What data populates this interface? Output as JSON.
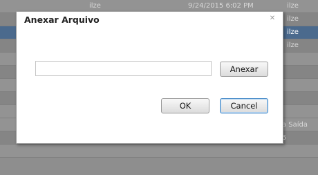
{
  "background": {
    "rows": [
      {
        "user": "ilze",
        "date": "9/24/2015 6:02 PM",
        "right": "ilze"
      },
      {
        "user": "",
        "date": "",
        "right": "ilze"
      },
      {
        "user": "",
        "date": "",
        "right": "ilze"
      },
      {
        "user": "",
        "date": "",
        "right": "ilze"
      },
      {
        "user": "",
        "date": "",
        "right": ""
      },
      {
        "user": "",
        "date": "",
        "right": ""
      },
      {
        "user": "",
        "date": "",
        "right": ""
      },
      {
        "user": "",
        "date": "",
        "right": ""
      },
      {
        "user": "",
        "date": "",
        "right": "a Saída"
      },
      {
        "user": "",
        "date": "",
        "right": "5"
      }
    ]
  },
  "dialog": {
    "title": "Anexar Arquivo",
    "close_glyph": "✕",
    "file_input": {
      "value": "",
      "placeholder": ""
    },
    "attach_button": "Anexar",
    "ok_button": "OK",
    "cancel_button": "Cancel"
  },
  "colors": {
    "overlay": "#8e8e8e",
    "selected_row": "#4b6a8d",
    "focus_border": "#3f86c6"
  }
}
